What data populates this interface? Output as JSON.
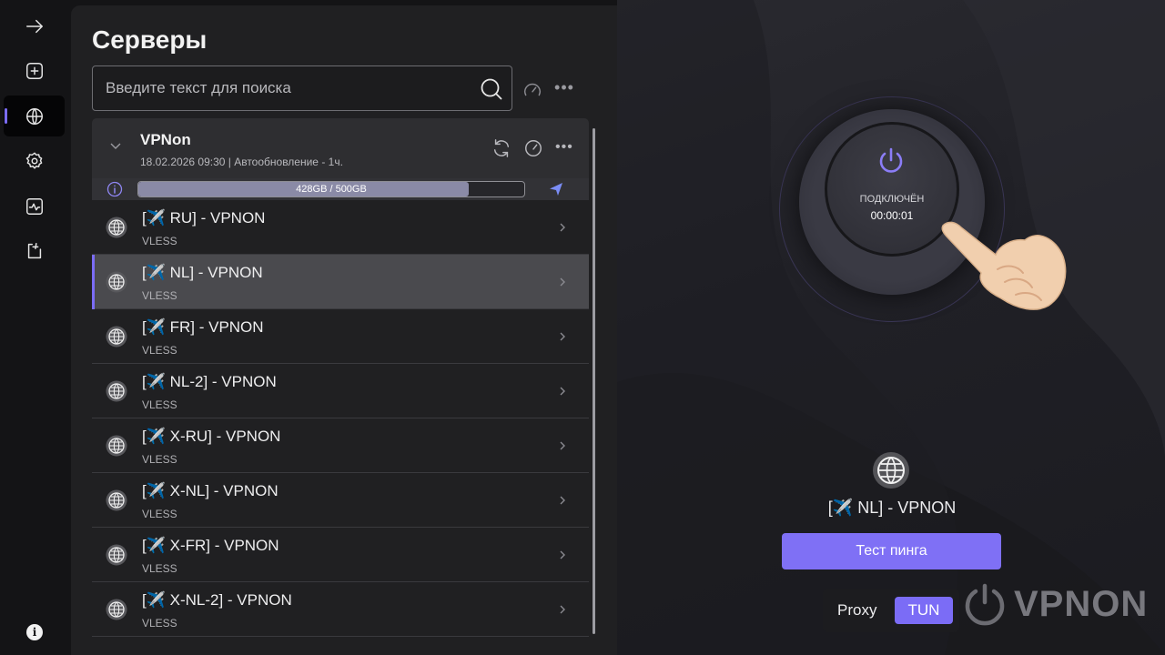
{
  "sidebar": {
    "items": [
      {
        "icon": "arrow-right-icon",
        "active": false
      },
      {
        "icon": "add-square-icon",
        "active": false
      },
      {
        "icon": "globe-icon",
        "active": true
      },
      {
        "icon": "gear-icon",
        "active": false
      },
      {
        "icon": "activity-chart-icon",
        "active": false
      },
      {
        "icon": "exit-icon",
        "active": false
      }
    ],
    "info_icon": "info-icon",
    "info_glyph": "i"
  },
  "servers": {
    "title": "Серверы",
    "search": {
      "placeholder": "Введите текст для поиска",
      "value": ""
    },
    "more_glyph": "•••",
    "group": {
      "name": "VPNon",
      "meta": "18.02.2026 09:30 | Автообновление - 1ч.",
      "usage_text": "428GB / 500GB",
      "usage_fraction": 0.856
    },
    "items": [
      {
        "title": "[✈️ RU] - VPNON",
        "protocol": "VLESS",
        "selected": false
      },
      {
        "title": "[✈️ NL] - VPNON",
        "protocol": "VLESS",
        "selected": true
      },
      {
        "title": "[✈️ FR] - VPNON",
        "protocol": "VLESS",
        "selected": false
      },
      {
        "title": "[✈️ NL-2] - VPNON",
        "protocol": "VLESS",
        "selected": false
      },
      {
        "title": "[✈️ X-RU] - VPNON",
        "protocol": "VLESS",
        "selected": false
      },
      {
        "title": "[✈️ X-NL] - VPNON",
        "protocol": "VLESS",
        "selected": false
      },
      {
        "title": "[✈️ X-FR] - VPNON",
        "protocol": "VLESS",
        "selected": false
      },
      {
        "title": "[✈️ X-NL-2] - VPNON",
        "protocol": "VLESS",
        "selected": false
      }
    ]
  },
  "connection": {
    "status": "ПОДКЛЮЧЁН",
    "timer": "00:00:01",
    "selected_server": "[✈️ NL] - VPNON",
    "ping_button": "Тест пинга",
    "mode_proxy": "Proxy",
    "mode_tun": "TUN",
    "active_mode": "TUN",
    "brand": "VPNON"
  },
  "colors": {
    "accent": "#7b6cf6",
    "button": "#7f70f5",
    "panel": "#202022",
    "background": "#141416"
  }
}
